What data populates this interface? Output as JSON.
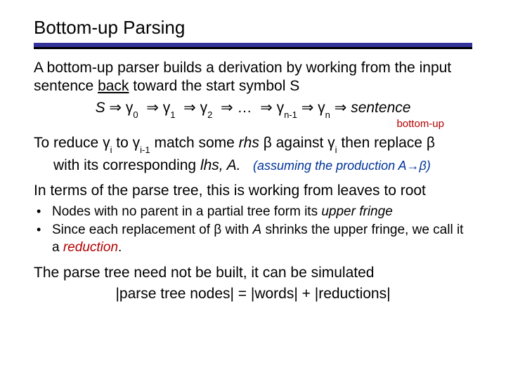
{
  "title": "Bottom-up Parsing",
  "p1a": "A bottom-up parser builds a derivation by working from the input sentence ",
  "p1_back": "back",
  "p1b": " toward the start symbol S",
  "deriv_S": "S",
  "arr": "⇒",
  "g": "γ",
  "s0": "0",
  "s1": "1",
  "s2": "2",
  "dots": "…",
  "snm1": "n-1",
  "sn": "n",
  "sentence": "sentence",
  "annot": "bottom-up",
  "p2a": "To reduce ",
  "p2b": " to ",
  "si": "i",
  "sim1": "i-1",
  "p2c": " match some ",
  "rhs": "rhs",
  "p2d": " β against ",
  "p2e": " then replace β",
  "p2f": "with its corresponding ",
  "lhs_A": "lhs, A.",
  "assume": "(assuming the production A→β)",
  "p3": "In terms of the parse tree, this is working from leaves to root",
  "b1a": "Nodes  with no parent in a partial tree form its ",
  "b1b": "upper fringe",
  "b2a": "Since each replacement of β with ",
  "b2A": "A",
  "b2b": " shrinks the upper fringe, we call it a ",
  "b2c": "reduction",
  "b2d": ".",
  "p4": "The parse tree need not be built, it can be simulated",
  "p5": "|parse tree nodes|  =  |words| + |reductions|"
}
